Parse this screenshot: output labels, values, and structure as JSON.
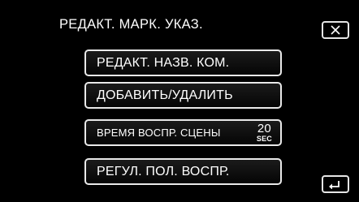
{
  "header": {
    "title": "РЕДАКТ. МАРК. УКАЗ."
  },
  "icons": {
    "close": "close-icon",
    "back": "back-arrow-icon"
  },
  "menu": {
    "items": [
      {
        "label": "РЕДАКТ. НАЗВ. КОМ."
      },
      {
        "label": "ДОБАВИТЬ/УДАЛИТЬ"
      },
      {
        "label": "ВРЕМЯ ВОСПР. СЦЕНЫ",
        "value": "20",
        "unit": "SEC"
      },
      {
        "label": "РЕГУЛ. ПОЛ. ВОСПР."
      }
    ]
  },
  "colors": {
    "background": "#000000",
    "text": "#ffffff",
    "border": "#e9e9e9"
  }
}
